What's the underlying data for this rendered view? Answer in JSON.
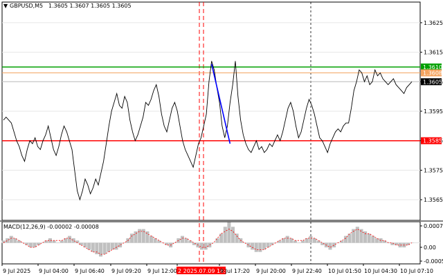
{
  "chart_data": [
    {
      "type": "line",
      "header": {
        "symbol_label": "GBPUSD,M5",
        "ohlc": "1.3605 1.3607 1.3605 1.3605",
        "arrow_icon": "triangle-down-icon"
      },
      "ylim": [
        1.3558,
        1.3632
      ],
      "y_ticks": [
        "1.3625",
        "1.3615",
        "1.3605",
        "1.3595",
        "1.3585",
        "1.3575",
        "1.3565"
      ],
      "x_labels": [
        "9 Jul 2025",
        "9 Jul 04:00",
        "9 Jul 06:40",
        "9 Jul 09:20",
        "9 Jul 12:00",
        "2 2025.07.09 16:10",
        "9 Jul 17:20",
        "9 Jul 20:00",
        "9 Jul 22:40",
        "10 Jul 01:50",
        "10 Jul 04:30",
        "10 Jul 07:10"
      ],
      "grid": true,
      "series": [
        {
          "color": "#000000",
          "values": [
            1.3592,
            1.3593,
            1.3592,
            1.3591,
            1.3588,
            1.3585,
            1.3583,
            1.358,
            1.3578,
            1.3582,
            1.3585,
            1.3584,
            1.3586,
            1.3583,
            1.3582,
            1.3585,
            1.3587,
            1.359,
            1.3586,
            1.3582,
            1.358,
            1.3583,
            1.3587,
            1.359,
            1.3588,
            1.3585,
            1.3582,
            1.3575,
            1.3568,
            1.3565,
            1.3568,
            1.3572,
            1.357,
            1.3567,
            1.3569,
            1.3572,
            1.357,
            1.3574,
            1.3578,
            1.3584,
            1.359,
            1.3595,
            1.3598,
            1.3601,
            1.3597,
            1.3596,
            1.36,
            1.3598,
            1.3592,
            1.3588,
            1.3585,
            1.3587,
            1.359,
            1.3593,
            1.3598,
            1.3597,
            1.3599,
            1.3602,
            1.3604,
            1.36,
            1.3594,
            1.359,
            1.3588,
            1.3592,
            1.3596,
            1.3598,
            1.3595,
            1.359,
            1.3585,
            1.3582,
            1.358,
            1.3578,
            1.3576,
            1.358,
            1.3584,
            1.3586,
            1.359,
            1.3594,
            1.3605,
            1.3612,
            1.3609,
            1.3603,
            1.3598,
            1.359,
            1.3586,
            1.359,
            1.3598,
            1.3604,
            1.3612,
            1.36,
            1.3592,
            1.3587,
            1.3584,
            1.3582,
            1.3581,
            1.3583,
            1.3585,
            1.3582,
            1.3583,
            1.3581,
            1.3582,
            1.3584,
            1.3583,
            1.3585,
            1.3587,
            1.3585,
            1.3588,
            1.3592,
            1.3596,
            1.3598,
            1.3595,
            1.359,
            1.3586,
            1.3588,
            1.3592,
            1.3596,
            1.3599,
            1.3597,
            1.3594,
            1.359,
            1.3586,
            1.3585,
            1.3583,
            1.3581,
            1.3584,
            1.3586,
            1.3588,
            1.3589,
            1.3588,
            1.359,
            1.3591,
            1.3591,
            1.3596,
            1.3602,
            1.3605,
            1.3609,
            1.3608,
            1.3605,
            1.3607,
            1.3604,
            1.3605,
            1.3609,
            1.3607,
            1.3608,
            1.3606,
            1.3605,
            1.3604,
            1.3605,
            1.3606,
            1.3604,
            1.3603,
            1.3602,
            1.3601,
            1.3603,
            1.3604,
            1.3605
          ]
        }
      ],
      "levels": [
        {
          "value": 1.361,
          "label": "1.3610",
          "color": "#00a000"
        },
        {
          "value": 1.3608,
          "label": "1.3608",
          "color": "#f4a460"
        },
        {
          "value": 1.3605,
          "label": "1.3605",
          "color": "#000000"
        },
        {
          "value": 1.3585,
          "label": "1.3585",
          "color": "#ff0000"
        }
      ],
      "trendline": {
        "from": [
          79,
          1.3611
        ],
        "to": [
          86,
          1.3584
        ],
        "color": "#0000ff"
      },
      "colors": {
        "price": "#000000",
        "support": "#ff0000",
        "resistance": "#00a000",
        "marker": "#f4a460",
        "trend": "#0000ff",
        "vline_red": "#ff0000",
        "macd_hist": "#c0c0c0",
        "macd_signal": "#ff0000"
      }
    },
    {
      "type": "area",
      "title": "MACD(12,26,9) -0.00002 -0.00008",
      "ylim": [
        -8e-05,
        8e-05
      ],
      "y_ticks": [
        "0.00071",
        "0.00",
        "-0.00051"
      ],
      "histogram": [
        1e-05,
        2e-05,
        3e-05,
        2e-05,
        1e-05,
        0.0,
        -1e-05,
        -2e-05,
        -2e-05,
        -1e-05,
        0.0,
        1e-05,
        2e-05,
        1e-05,
        0.0,
        1e-05,
        2e-05,
        3e-05,
        2e-05,
        1e-05,
        -1e-05,
        -2e-05,
        -3e-05,
        -4e-05,
        -5e-05,
        -6e-05,
        -5e-05,
        -4e-05,
        -3e-05,
        -3e-05,
        -2e-05,
        0.0,
        2e-05,
        4e-05,
        5e-05,
        6e-05,
        6e-05,
        5e-05,
        3e-05,
        2e-05,
        1e-05,
        0.0,
        -1e-05,
        -2e-05,
        0.0,
        2e-05,
        3e-05,
        2e-05,
        1e-05,
        -1e-05,
        -2e-05,
        -3e-05,
        -3e-05,
        -2e-05,
        0.0,
        2e-05,
        4e-05,
        7e-05,
        9e-05,
        7e-05,
        4e-05,
        2e-05,
        0.0,
        -2e-05,
        -3e-05,
        -4e-05,
        -4e-05,
        -3e-05,
        -2e-05,
        -1e-05,
        0.0,
        1e-05,
        2e-05,
        3e-05,
        2e-05,
        1e-05,
        0.0,
        1e-05,
        2e-05,
        3e-05,
        2e-05,
        1e-05,
        -1e-05,
        -2e-05,
        -3e-05,
        -2e-05,
        0.0,
        1e-05,
        3e-05,
        4e-05,
        6e-05,
        7e-05,
        6e-05,
        5e-05,
        4e-05,
        3e-05,
        2e-05,
        2e-05,
        1e-05,
        0.0,
        -1e-05,
        -1e-05,
        -2e-05,
        -2e-05,
        -1e-05,
        0.0
      ],
      "signal": [
        0.0,
        1e-05,
        2e-05,
        2e-05,
        1e-05,
        0.0,
        -1e-05,
        -2e-05,
        -2e-05,
        -1e-05,
        0.0,
        1e-05,
        1e-05,
        1e-05,
        1e-05,
        1e-05,
        2e-05,
        2e-05,
        1e-05,
        0.0,
        -1e-05,
        -2e-05,
        -3e-05,
        -4e-05,
        -4e-05,
        -5e-05,
        -5e-05,
        -4e-05,
        -3e-05,
        -2e-05,
        -1e-05,
        0.0,
        1e-05,
        3e-05,
        4e-05,
        5e-05,
        5e-05,
        4e-05,
        3e-05,
        2e-05,
        1e-05,
        0.0,
        -1e-05,
        -1e-05,
        0.0,
        1e-05,
        2e-05,
        2e-05,
        1e-05,
        0.0,
        -1e-05,
        -2e-05,
        -2e-05,
        -1e-05,
        0.0,
        2e-05,
        4e-05,
        5e-05,
        6e-05,
        5e-05,
        3e-05,
        1e-05,
        0.0,
        -1e-05,
        -2e-05,
        -3e-05,
        -3e-05,
        -3e-05,
        -2e-05,
        -1e-05,
        0.0,
        1e-05,
        2e-05,
        2e-05,
        2e-05,
        1e-05,
        1e-05,
        1e-05,
        2e-05,
        2e-05,
        2e-05,
        1e-05,
        0.0,
        -1e-05,
        -2e-05,
        -1e-05,
        0.0,
        1e-05,
        2e-05,
        4e-05,
        5e-05,
        6e-05,
        5e-05,
        4e-05,
        4e-05,
        3e-05,
        2e-05,
        1e-05,
        1e-05,
        0.0,
        0.0,
        -1e-05,
        -1e-05,
        -1e-05,
        -1e-05,
        0.0
      ]
    }
  ]
}
